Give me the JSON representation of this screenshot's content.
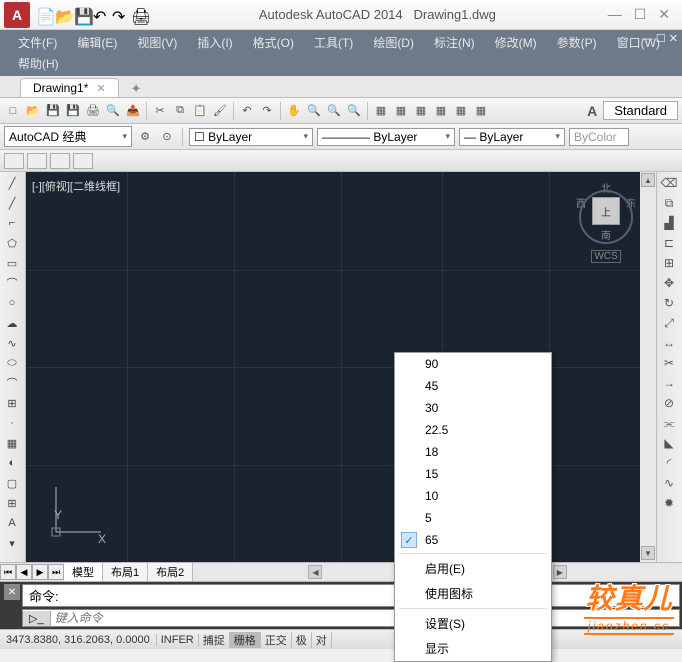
{
  "title_app": "Autodesk AutoCAD 2014",
  "title_doc": "Drawing1.dwg",
  "menu": {
    "file": "文件(F)",
    "edit": "编辑(E)",
    "view": "视图(V)",
    "insert": "插入(I)",
    "format": "格式(O)",
    "tools": "工具(T)",
    "draw": "绘图(D)",
    "dimension": "标注(N)",
    "modify": "修改(M)",
    "param": "参数(P)",
    "window": "窗口(W)",
    "help": "帮助(H)"
  },
  "tab": {
    "name": "Drawing1*"
  },
  "style_label": "Standard",
  "workspace": "AutoCAD 经典",
  "layer": "ByLayer",
  "linetype": "ByLayer",
  "lineweight": "ByLayer",
  "color": "ByColor",
  "canvas_label": "[-][俯视][二维线框]",
  "viewcube": {
    "n": "北",
    "s": "南",
    "e": "东",
    "w": "西",
    "face": "上",
    "wcs": "WCS"
  },
  "ucs": {
    "x": "X",
    "y": "Y"
  },
  "layout": {
    "model": "模型",
    "l1": "布局1",
    "l2": "布局2"
  },
  "cmd": {
    "label": "命令:",
    "placeholder": "键入命令",
    "prompt": "▷_"
  },
  "status": {
    "coords": "3473.8380, 316.2063, 0.0000",
    "infer": "INFER",
    "snap": "捕捉",
    "grid": "栅格",
    "ortho": "正交",
    "polar": "极",
    "osnap": "对"
  },
  "ctx": {
    "i0": "90",
    "i1": "45",
    "i2": "30",
    "i3": "22.5",
    "i4": "18",
    "i5": "15",
    "i6": "10",
    "i7": "5",
    "i8": "65",
    "enable": "启用(E)",
    "useimg": "使用图标",
    "settings": "设置(S)",
    "display": "显示"
  },
  "wm": {
    "main": "较真儿",
    "sub": "jiaozhen.cc"
  }
}
